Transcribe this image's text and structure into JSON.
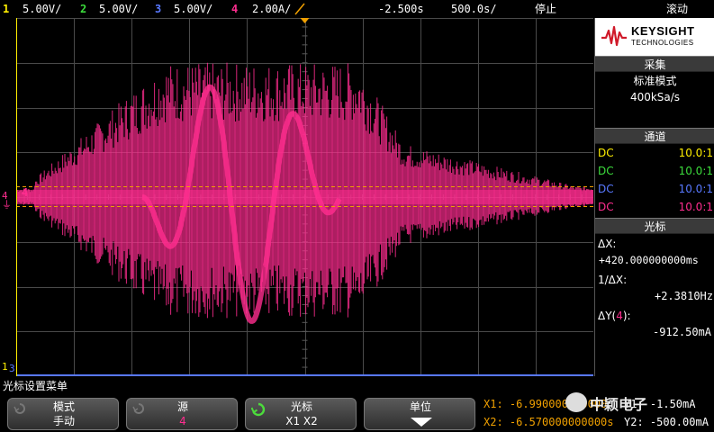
{
  "colors": {
    "ch1": "#ffef00",
    "ch2": "#3cdc3c",
    "ch3": "#5878ff",
    "ch4": "#ff2d8f",
    "accent_orange": "#f0a000",
    "header_gray": "#3a3a3a"
  },
  "topbar": {
    "ch1_num": "1",
    "ch1_scale": "5.00V/",
    "ch2_num": "2",
    "ch2_scale": "5.00V/",
    "ch3_num": "3",
    "ch3_scale": "5.00V/",
    "ch4_num": "4",
    "ch4_scale": "2.00A/",
    "trigger_icon": "trigger-slope-icon",
    "time_offset": "-2.500s",
    "time_scale": "500.0s/",
    "run_state": "停止",
    "mode": "滚动"
  },
  "plot": {
    "ch4_marker": "4",
    "ch3_marker": "3",
    "ch1_marker": "1"
  },
  "right_panel": {
    "logo_name": "KEYSIGHT",
    "logo_sub": "TECHNOLOGIES",
    "acquire_header": "采集",
    "acquire_mode": "标准模式",
    "acquire_rate": "400kSa/s",
    "channel_header": "通道",
    "channels": [
      {
        "coupling": "DC",
        "ratio": "10.0:1"
      },
      {
        "coupling": "DC",
        "ratio": "10.0:1"
      },
      {
        "coupling": "DC",
        "ratio": "10.0:1"
      },
      {
        "coupling": "DC",
        "ratio": "10.0:1"
      }
    ],
    "cursor_header": "光标",
    "dx_label": "ΔX:",
    "dx_value": "+420.000000000ms",
    "inv_dx_label": "1/ΔX:",
    "inv_dx_value": "+2.3810Hz",
    "dy_label_prefix": "ΔY(",
    "dy_label_ch": "4",
    "dy_label_suffix": "):",
    "dy_value": "-912.50mA"
  },
  "bottom": {
    "menu_title": "光标设置菜单",
    "softkeys": [
      {
        "label": "模式",
        "value": "手动"
      },
      {
        "label": "源",
        "value": "4"
      },
      {
        "label": "光标",
        "value": "X1 X2"
      },
      {
        "label": "单位",
        "value": ""
      }
    ],
    "x1": "X1: -6.990000000000",
    "x2": "X2: -6.570000000000s",
    "y1": "Y1: -1.50mA",
    "y2": "Y2: -500.00mA",
    "watermark": "中颖电子"
  }
}
